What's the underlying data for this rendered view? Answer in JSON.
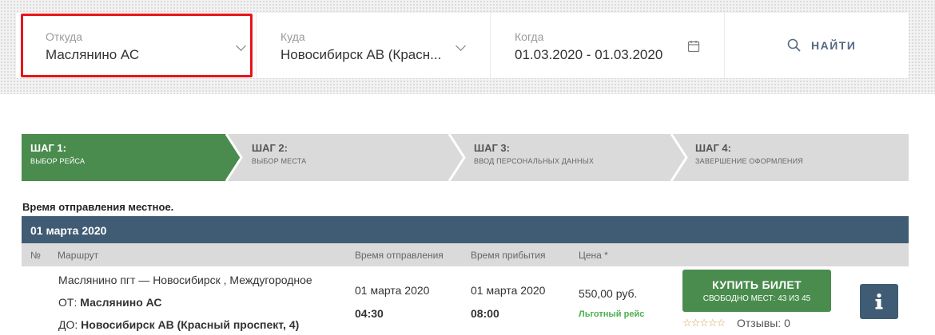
{
  "search": {
    "from": {
      "label": "Откуда",
      "value": "Маслянино АС"
    },
    "to": {
      "label": "Куда",
      "value": "Новосибирск АВ (Красн..."
    },
    "when": {
      "label": "Когда",
      "value": "01.03.2020 - 01.03.2020"
    },
    "find_label": "НАЙТИ"
  },
  "steps": [
    {
      "title": "ШАГ 1:",
      "subtitle": "ВЫБОР РЕЙСА",
      "active": true
    },
    {
      "title": "ШАГ 2:",
      "subtitle": "ВЫБОР МЕСТА",
      "active": false
    },
    {
      "title": "ШАГ 3:",
      "subtitle": "ВВОД ПЕРСОНАЛЬНЫХ ДАННЫХ",
      "active": false
    },
    {
      "title": "ШАГ 4:",
      "subtitle": "ЗАВЕРШЕНИЕ ОФОРМЛЕНИЯ",
      "active": false
    }
  ],
  "colors": {
    "accent_green": "#4a8c4e",
    "navy": "#3f5c74",
    "highlight_red": "#e8141a",
    "step_inactive": "#dadada"
  },
  "note": "Время отправления местное.",
  "date_header": "01 марта 2020",
  "table": {
    "headers": {
      "num": "№",
      "route": "Маршрут",
      "departure": "Время отправления",
      "arrival": "Время прибытия",
      "price": "Цена *"
    },
    "row": {
      "route_title": "Маслянино пгт — Новосибирск , Междугородное",
      "from_label": "ОТ:",
      "from_value": "Маслянино АС",
      "to_label": "ДО:",
      "to_value": "Новосибирск АВ (Красный проспект, 4)",
      "dep_date": "01 марта 2020",
      "dep_time": "04:30",
      "arr_date": "01 марта 2020",
      "arr_time": "08:00",
      "price": "550,00 руб.",
      "discount_label": "Льготный рейс",
      "buy_label": "КУПИТЬ БИЛЕТ",
      "seats_label": "СВОБОДНО МЕСТ: 43 ИЗ 45",
      "stars": "☆☆☆☆☆",
      "reviews_label": "Отзывы: 0",
      "info_icon": "info-icon"
    }
  }
}
